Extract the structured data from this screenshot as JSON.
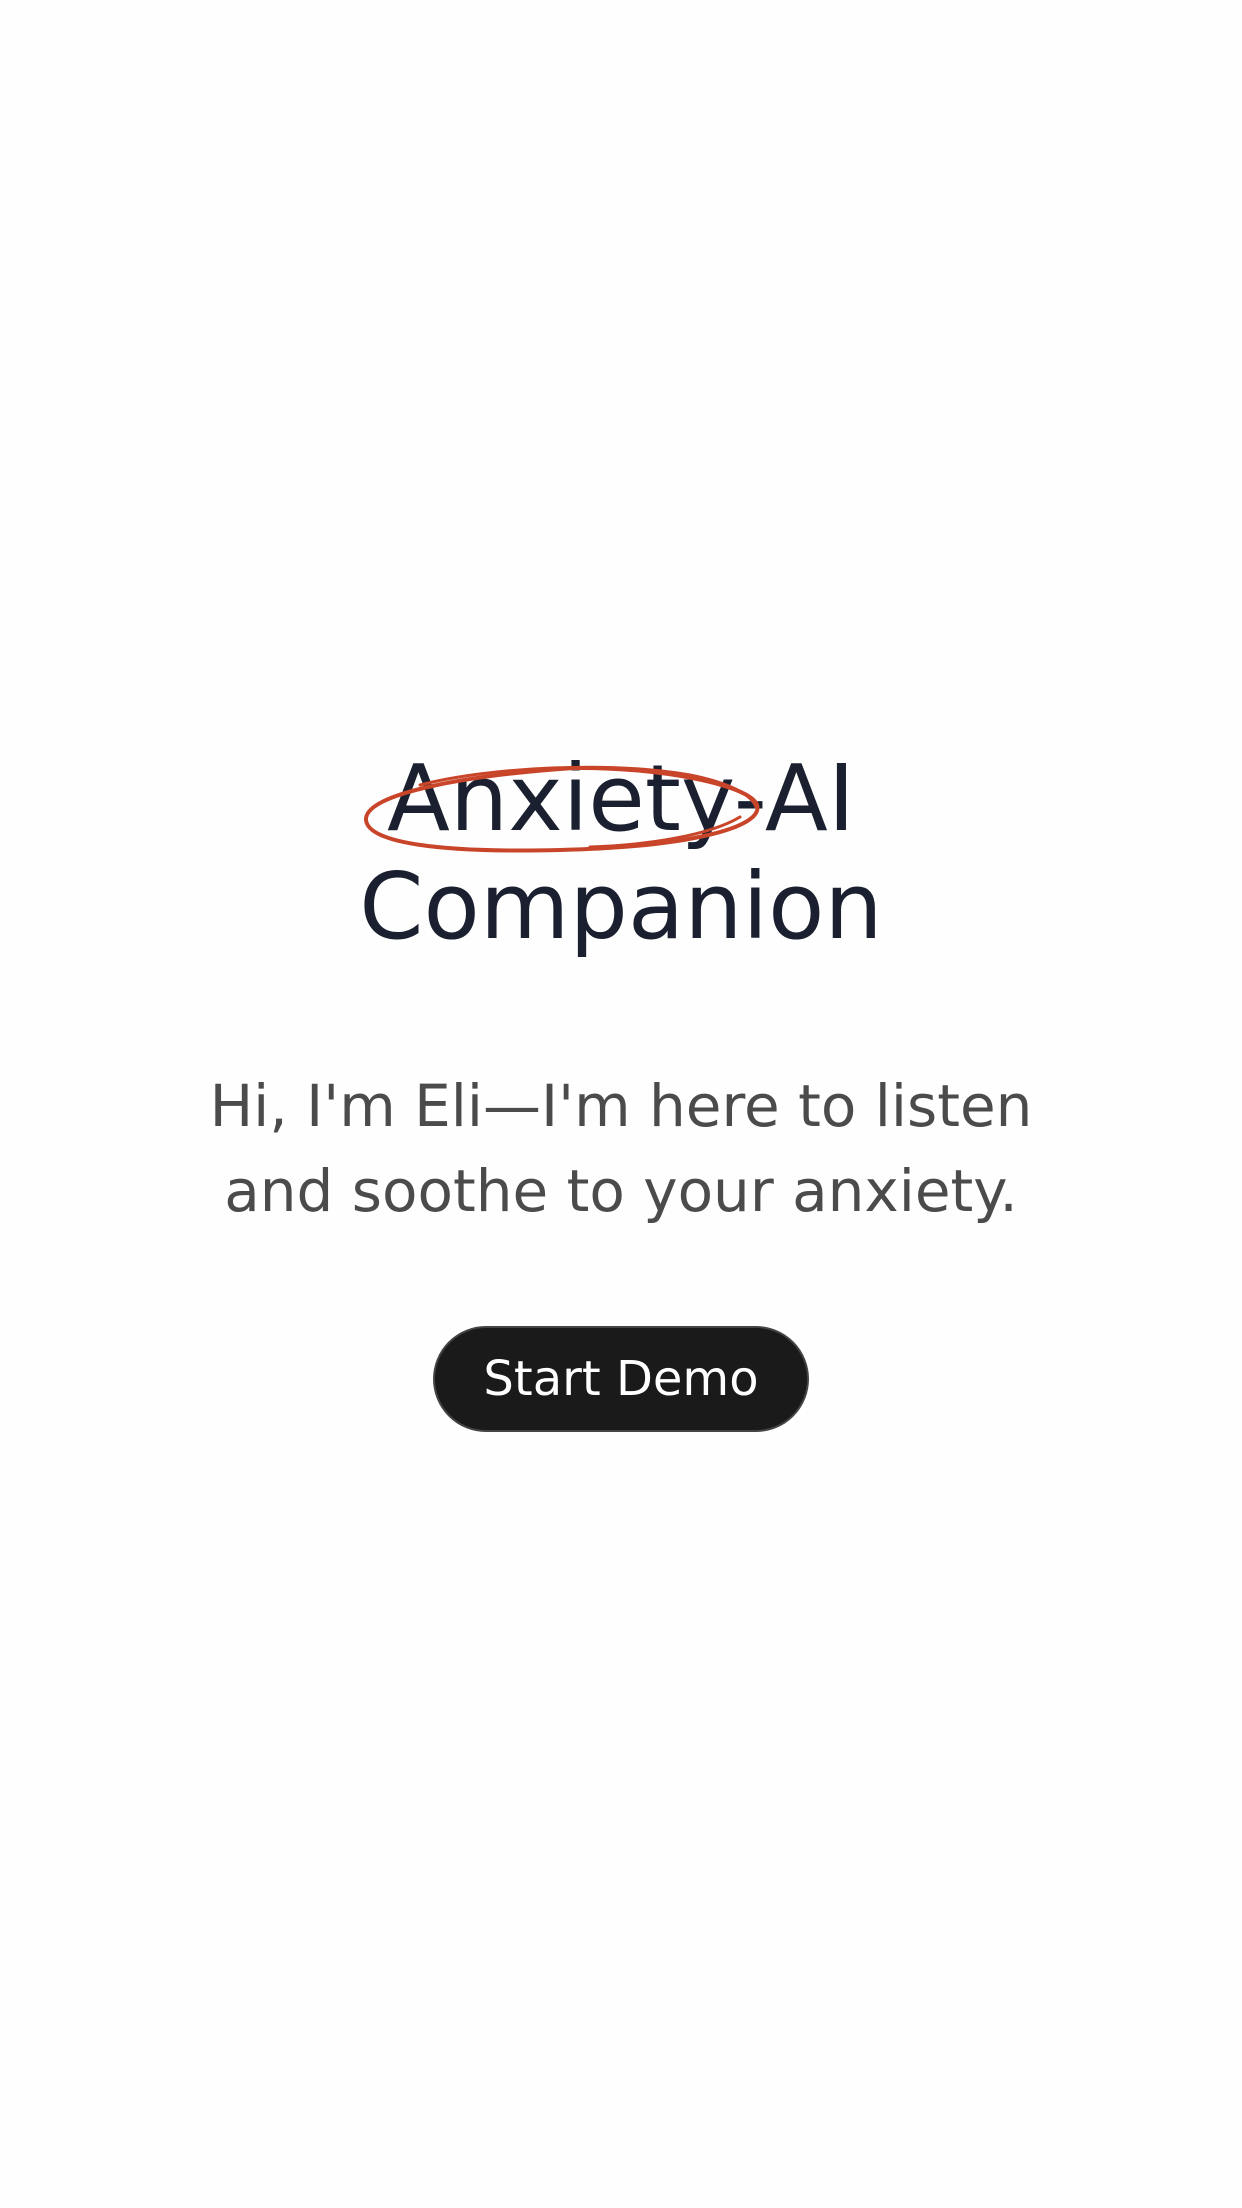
{
  "hero": {
    "title_line1": "Anxiety-AI",
    "title_line2": "Companion",
    "subtitle_line1": "Hi, I'm Eli—I'm here to listen",
    "subtitle_line2": "and soothe to your anxiety."
  },
  "actions": {
    "start_label": "Start Demo"
  },
  "colors": {
    "title": "#1b2030",
    "subtitle": "#4b4b4b",
    "button_bg": "#1a1a1a",
    "button_text": "#ffffff",
    "scribble": "#c9452a"
  },
  "annotation": {
    "icon": "hand-drawn-ellipse-icon"
  }
}
